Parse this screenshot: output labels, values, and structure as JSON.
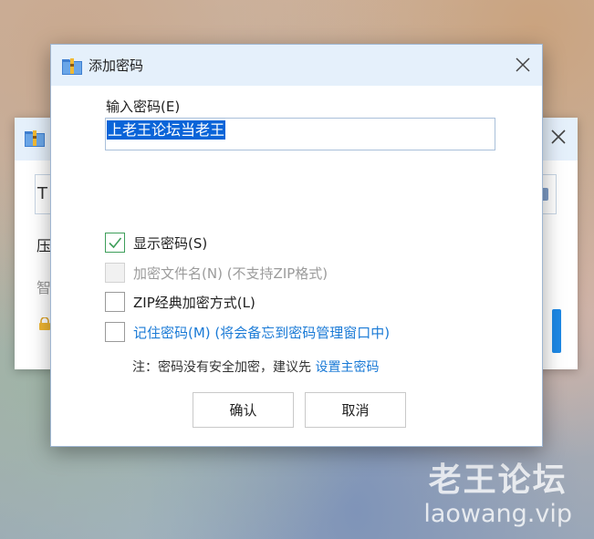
{
  "background_window": {
    "input_text": "T",
    "label_text": "压",
    "hint_text": "智"
  },
  "dialog": {
    "title": "添加密码",
    "password_label": "输入密码(E)",
    "password_value": "上老王论坛当老王",
    "options": [
      {
        "label": "显示密码(S)",
        "checked": true,
        "disabled": false
      },
      {
        "label": "加密文件名(N) (不支持ZIP格式)",
        "checked": false,
        "disabled": true
      },
      {
        "label": "ZIP经典加密方式(L)",
        "checked": false,
        "disabled": false
      },
      {
        "label": "记住密码(M) (将会备忘到密码管理窗口中)",
        "checked": false,
        "disabled": false
      }
    ],
    "note_prefix": "注：密码没有安全加密，建议先",
    "note_link": "设置主密码",
    "ok_label": "确认",
    "cancel_label": "取消"
  },
  "watermark": {
    "title": "老王论坛",
    "url": "laowang.vip"
  },
  "colors": {
    "titlebar": "#e5f0fb",
    "selection": "#0a64d8",
    "link": "#1a7ad6",
    "check": "#3e9e5a"
  },
  "icons": {
    "app": "archive-folder-icon",
    "close": "close-icon",
    "check": "checkmark-icon",
    "lock": "lock-icon"
  }
}
